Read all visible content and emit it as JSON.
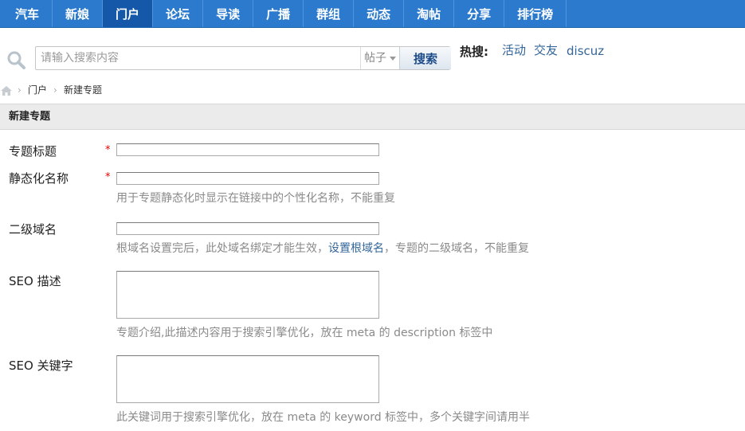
{
  "nav": {
    "items": [
      {
        "label": "汽车",
        "active": false
      },
      {
        "label": "新娘",
        "active": false
      },
      {
        "label": "门户",
        "active": true
      },
      {
        "label": "论坛",
        "active": false
      },
      {
        "label": "导读",
        "active": false
      },
      {
        "label": "广播",
        "active": false
      },
      {
        "label": "群组",
        "active": false
      },
      {
        "label": "动态",
        "active": false
      },
      {
        "label": "淘帖",
        "active": false
      },
      {
        "label": "分享",
        "active": false
      },
      {
        "label": "排行榜",
        "active": false
      }
    ]
  },
  "search": {
    "placeholder": "请输入搜索内容",
    "type_value": "帖子",
    "button_label": "搜索",
    "icon": "magnifier-icon",
    "hot_label": "热搜:",
    "hot_links": [
      "活动",
      "交友",
      "discuz"
    ]
  },
  "breadcrumb": {
    "home_icon": "home-icon",
    "items": [
      "门户",
      "新建专题"
    ]
  },
  "panel": {
    "title": "新建专题"
  },
  "form": {
    "title_label": "专题标题",
    "static_name_label": "静态化名称",
    "static_name_tip": "用于专题静态化时显示在链接中的个性化名称，不能重复",
    "domain_label": "二级域名",
    "domain_tip_prefix": "根域名设置完后，此处域名绑定才能生效，",
    "domain_tip_link": "设置根域名",
    "domain_tip_suffix": "，专题的二级域名，不能重复",
    "seo_desc_label": "SEO 描述",
    "seo_desc_tip": "专题介绍,此描述内容用于搜索引擎优化，放在  meta 的  description 标签中",
    "seo_kw_label": "SEO 关键字",
    "seo_kw_tip": "此关键词用于搜索引擎优化，放在  meta 的  keyword 标签中，多个关键字间请用半",
    "required_mark": "*"
  },
  "colors": {
    "nav_bg": "#2b7acd",
    "nav_active": "#1557a8",
    "link": "#336699",
    "required": "#e00000"
  }
}
